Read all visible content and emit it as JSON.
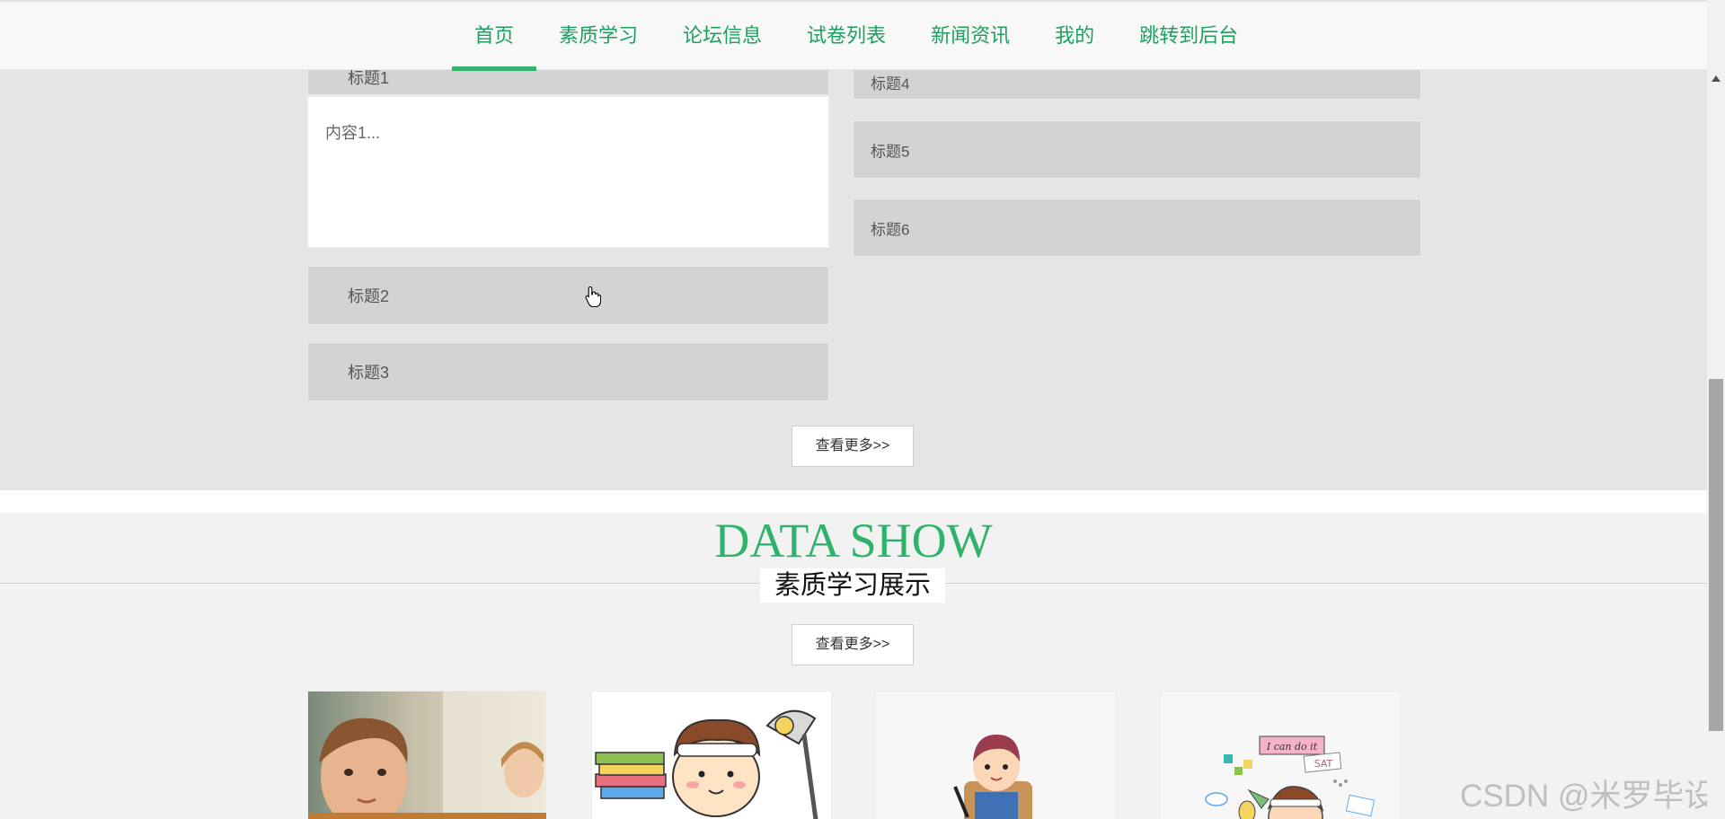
{
  "nav": {
    "items": [
      {
        "label": "首页",
        "active": true
      },
      {
        "label": "素质学习"
      },
      {
        "label": "论坛信息"
      },
      {
        "label": "试卷列表"
      },
      {
        "label": "新闻资讯"
      },
      {
        "label": "我的"
      },
      {
        "label": "跳转到后台"
      }
    ]
  },
  "accordion": {
    "left": [
      {
        "title": "标题1"
      },
      {
        "title": "标题2"
      },
      {
        "title": "标题3"
      }
    ],
    "left_content": "内容1...",
    "right": [
      {
        "title": "标题4"
      },
      {
        "title": "标题5"
      },
      {
        "title": "标题6"
      }
    ],
    "more_label": "查看更多>>"
  },
  "data_show": {
    "title": "DATA SHOW",
    "subtitle": "素质学习展示",
    "more_label": "查看更多>>",
    "cards": [
      {
        "image": "boy-thinking-photo"
      },
      {
        "image": "cartoon-boy-studying-lamp"
      },
      {
        "image": "cartoon-student-writing"
      },
      {
        "image": "cartoon-i-can-do-it",
        "caption": "I can do it",
        "tag": "SAT"
      }
    ]
  },
  "watermark": "CSDN @米罗毕设",
  "colors": {
    "accent": "#2fb26b",
    "nav_text": "#1f9f5f",
    "section_gray": "#e5e5e5",
    "panel_gray": "#d3d3d3"
  }
}
